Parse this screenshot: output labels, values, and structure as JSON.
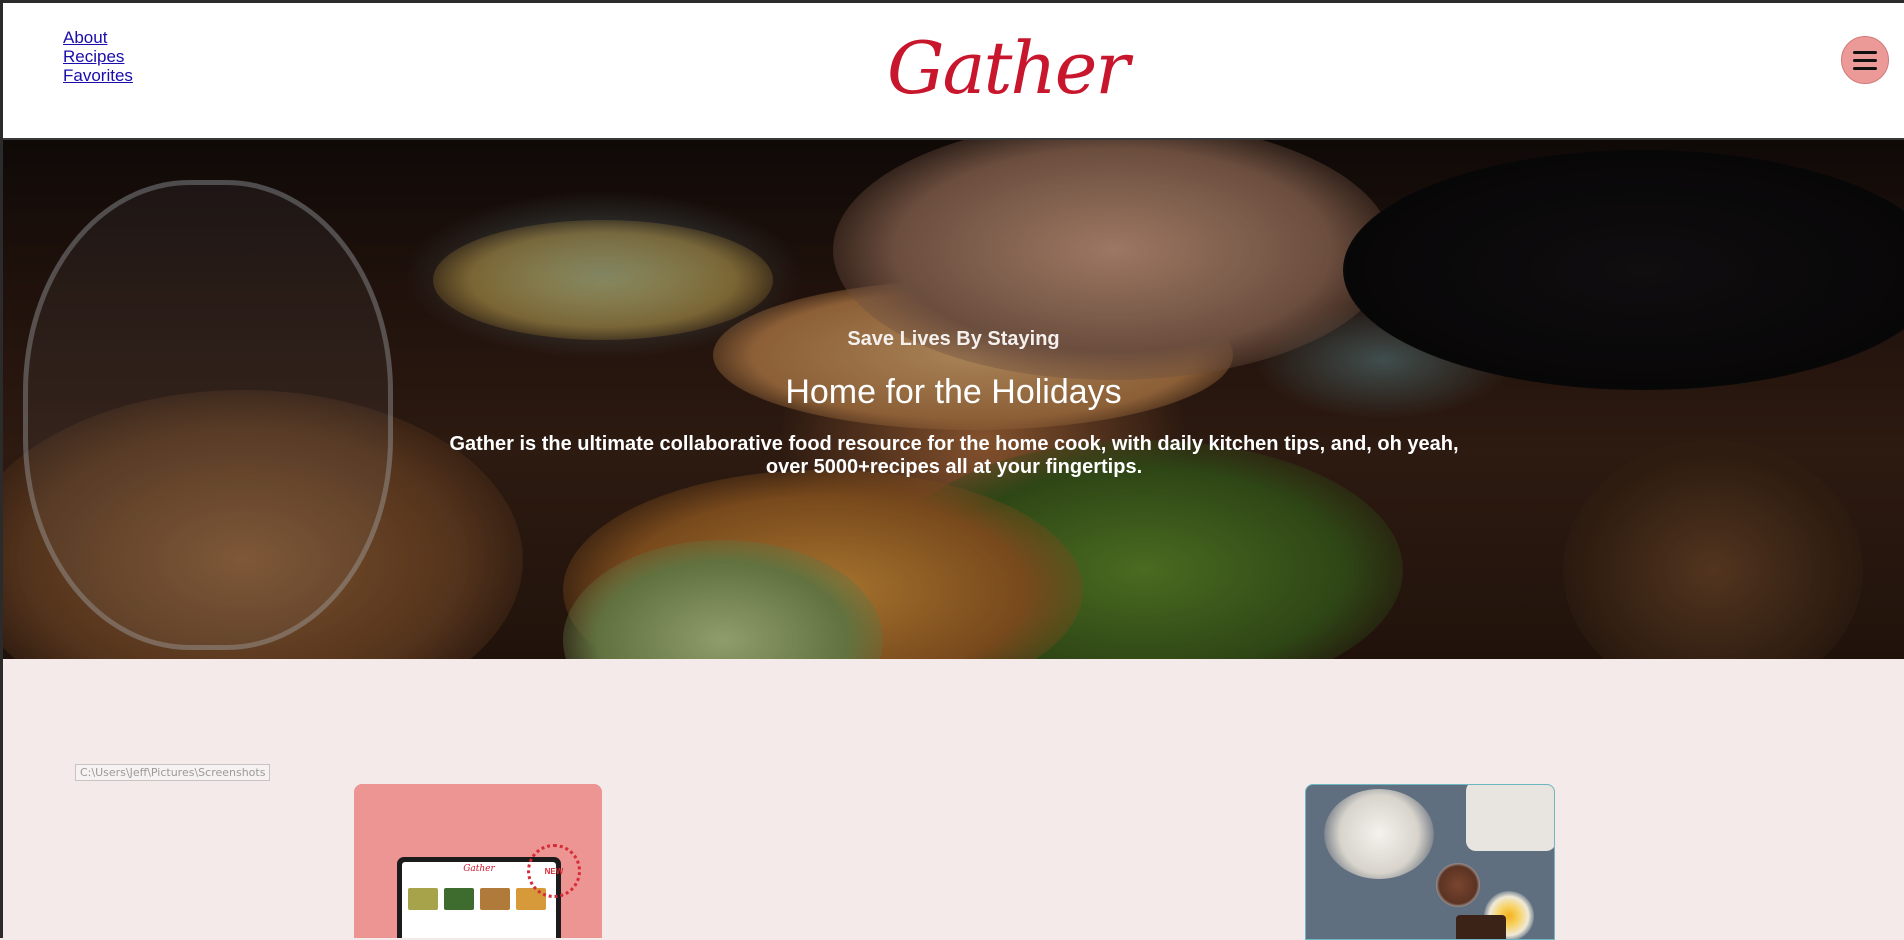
{
  "nav": {
    "links": [
      "About",
      "Recipes",
      "Favorites"
    ]
  },
  "brand": {
    "name": "Gather",
    "accent": "#c8162d"
  },
  "menu": {
    "icon": "hamburger-menu-icon",
    "color": "#ec9a98"
  },
  "hero": {
    "eyebrow": "Save Lives By Staying",
    "title": "Home for the Holidays",
    "description": "Gather is the ultimate collaborative food resource for the home cook, with daily kitchen tips, and, oh yeah, over 5000+recipes all at your fingertips."
  },
  "tooltip": {
    "text": "C:\\Users\\Jeff\\Pictures\\Screenshots"
  },
  "cards": {
    "new_badge": "NEW",
    "tablet_logo": "Gather"
  },
  "colors": {
    "page_bg": "#f4eaea",
    "card_pink": "#ec9593"
  }
}
